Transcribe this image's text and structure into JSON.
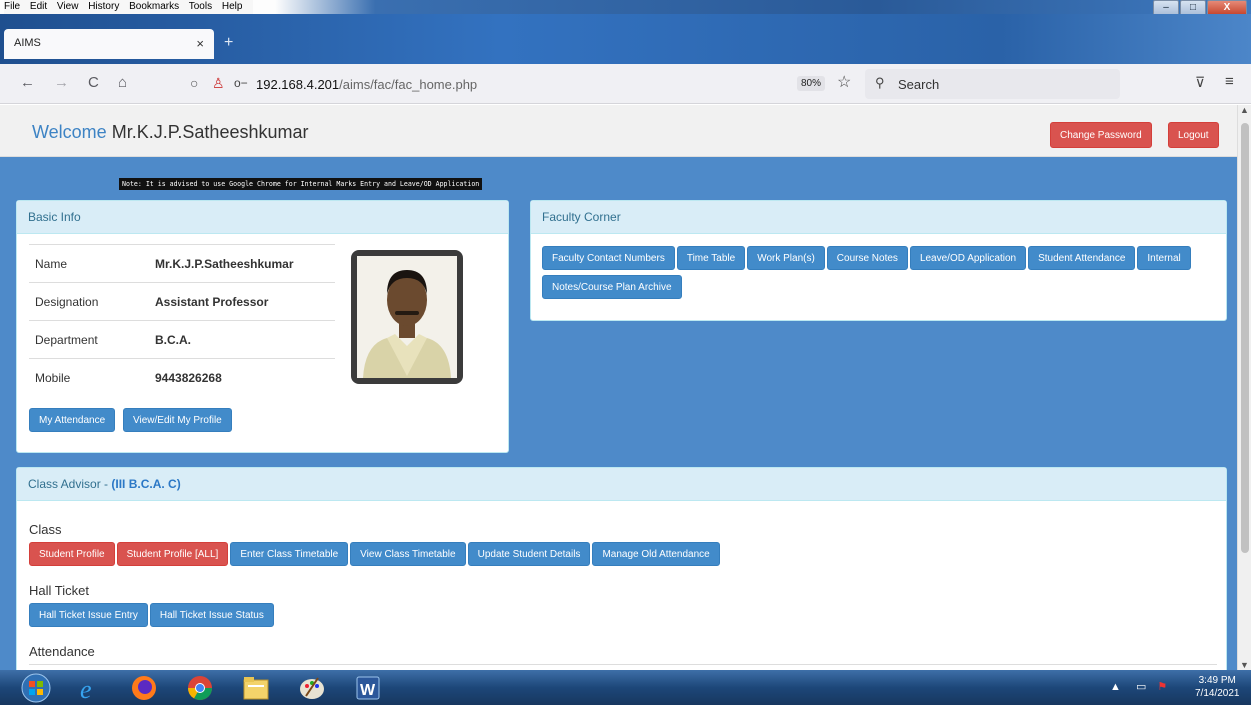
{
  "menubar": {
    "items": [
      "File",
      "Edit",
      "View",
      "History",
      "Bookmarks",
      "Tools",
      "Help"
    ]
  },
  "window_controls": {
    "minimize": "–",
    "maximize": "□",
    "close": "X"
  },
  "tab": {
    "title": "AIMS",
    "close": "×",
    "new_tab": "+"
  },
  "nav": {
    "back": "←",
    "forward": "→",
    "reload": "C",
    "home": "⌂",
    "url_host": "192.168.4.201",
    "url_path": "/aims/fac/fac_home.php",
    "zoom": "80%",
    "search_placeholder": "Search"
  },
  "header": {
    "welcome": "Welcome",
    "user": "Mr.K.J.P.Satheeshkumar",
    "change_password": "Change Password",
    "logout": "Logout"
  },
  "note": "Note: It is advised to use Google Chrome for Internal Marks Entry and Leave/OD Application",
  "basic_info": {
    "title": "Basic Info",
    "rows": [
      {
        "label": "Name",
        "value": "Mr.K.J.P.Satheeshkumar"
      },
      {
        "label": "Designation",
        "value": "Assistant Professor"
      },
      {
        "label": "Department",
        "value": "B.C.A."
      },
      {
        "label": "Mobile",
        "value": "9443826268"
      }
    ],
    "my_attendance": "My Attendance",
    "edit_profile": "View/Edit My Profile"
  },
  "faculty_corner": {
    "title": "Faculty Corner",
    "buttons": [
      "Faculty Contact Numbers",
      "Time Table",
      "Work Plan(s)",
      "Course Notes",
      "Leave/OD Application",
      "Student Attendance",
      "Internal",
      "Notes/Course Plan Archive"
    ]
  },
  "class_advisor": {
    "title": "Class Advisor - ",
    "class_name": "(III B.C.A. C)",
    "class_section": "Class",
    "class_buttons": [
      {
        "label": "Student Profile",
        "color": "red"
      },
      {
        "label": "Student Profile [ALL]",
        "color": "red"
      },
      {
        "label": "Enter Class Timetable",
        "color": "blue"
      },
      {
        "label": "View Class Timetable",
        "color": "blue"
      },
      {
        "label": "Update Student Details",
        "color": "blue"
      },
      {
        "label": "Manage Old Attendance",
        "color": "blue"
      }
    ],
    "hall_ticket_section": "Hall Ticket",
    "hall_ticket_buttons": [
      "Hall Ticket Issue Entry",
      "Hall Ticket Issue Status"
    ],
    "attendance_section": "Attendance"
  },
  "taskbar": {
    "apps": [
      "start-orb",
      "internet-explorer",
      "firefox",
      "chrome",
      "file-explorer",
      "paint",
      "word"
    ],
    "time": "3:49 PM",
    "date": "7/14/2021"
  },
  "colors": {
    "primary": "#428bca",
    "danger": "#d9534f",
    "page_bg": "#4e8ac9",
    "panel_head": "#d9edf7"
  }
}
